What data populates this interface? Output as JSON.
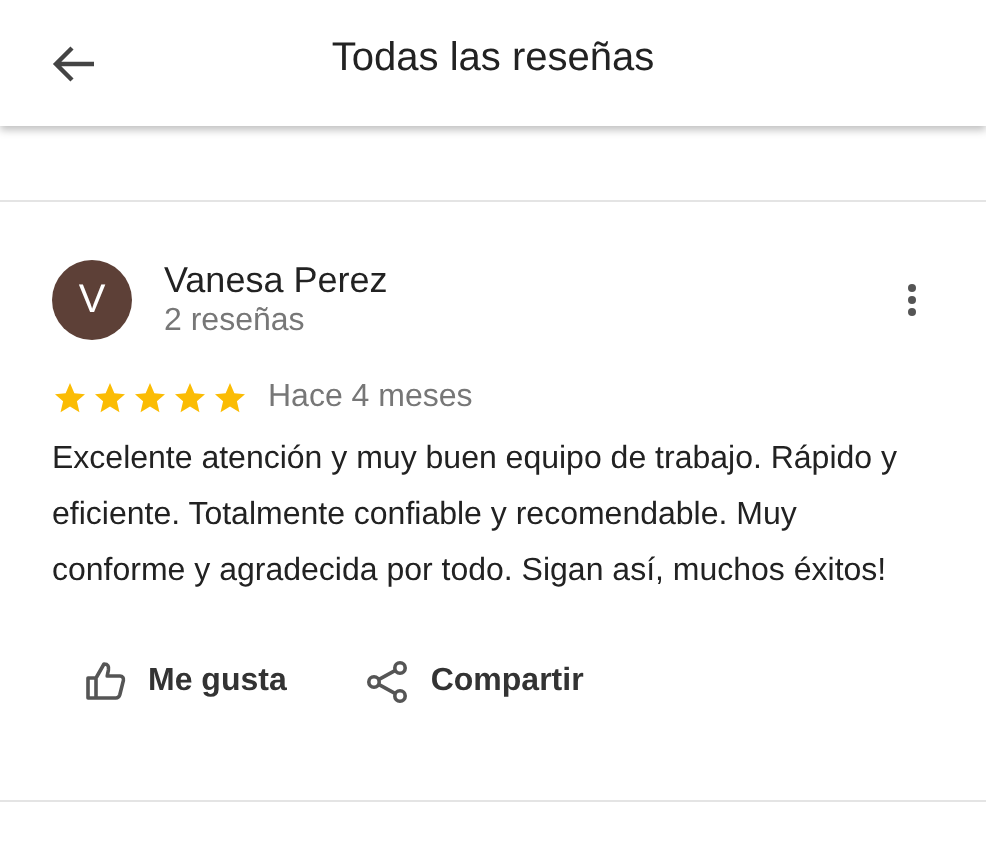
{
  "header": {
    "title": "Todas las reseñas"
  },
  "review": {
    "avatar_letter": "V",
    "author": "Vanesa Perez",
    "author_meta": "2 reseñas",
    "stars": 5,
    "time": "Hace 4 meses",
    "text": "Excelente atención y muy buen equipo de trabajo. Rápido y eficiente. Totalmente confiable y recomendable. Muy conforme y agradecida por todo. Sigan así, muchos éxitos!",
    "actions": [
      {
        "kind": "like",
        "label": "Me gusta"
      },
      {
        "kind": "share",
        "label": "Compartir"
      }
    ]
  }
}
